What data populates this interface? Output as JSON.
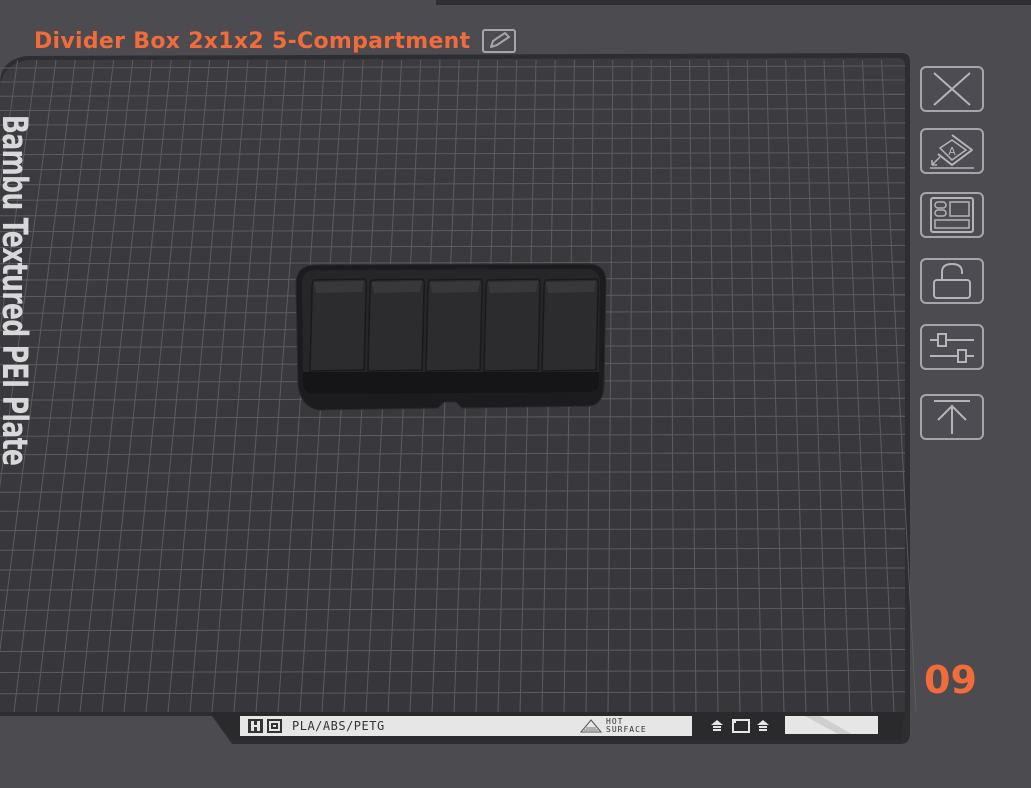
{
  "plate": {
    "title": "Divider Box 2x1x2 5-Compartment",
    "edit_icon": "edit-icon",
    "bed_label": "Bambu Textured PEI Plate",
    "index": "09"
  },
  "toolbar": {
    "items": [
      {
        "name": "delete-plate",
        "icon": "close-icon"
      },
      {
        "name": "auto-orient",
        "icon": "orient-icon"
      },
      {
        "name": "arrange",
        "icon": "arrange-icon"
      },
      {
        "name": "lock",
        "icon": "lock-icon"
      },
      {
        "name": "plate-settings",
        "icon": "settings-sliders-icon"
      },
      {
        "name": "move-to-top",
        "icon": "arrow-up-icon"
      }
    ]
  },
  "bed_footer": {
    "materials": "PLA/ABS/PETG",
    "hot_line1": "HOT",
    "hot_line2": "SURFACE"
  },
  "colors": {
    "accent": "#f26b3a",
    "background": "#4b4b50",
    "bed": "#3a3a3e",
    "grid": "#5a5a5f"
  }
}
